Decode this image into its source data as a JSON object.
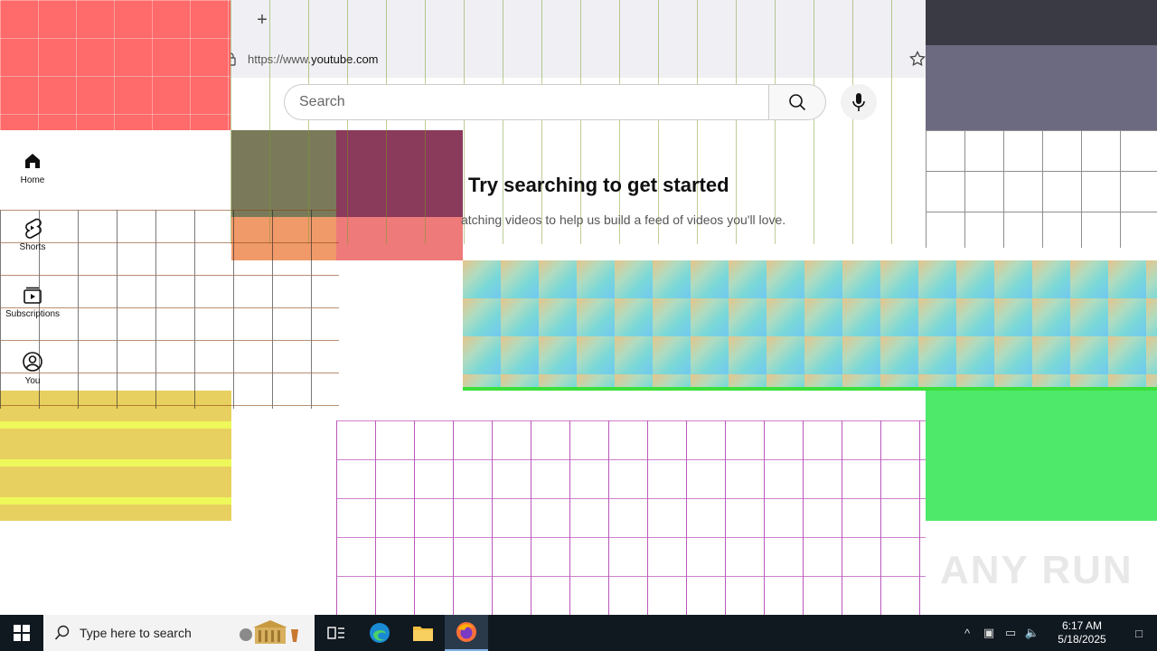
{
  "browser": {
    "url_prefix": "https://www.",
    "url_domain": "youtube.com",
    "newtab_symbol": "+"
  },
  "youtube": {
    "search_placeholder": "Search",
    "nav": [
      {
        "label": "Home",
        "icon": "home-icon"
      },
      {
        "label": "Shorts",
        "icon": "shorts-icon"
      },
      {
        "label": "Subscriptions",
        "icon": "subscriptions-icon"
      },
      {
        "label": "You",
        "icon": "account-icon"
      }
    ],
    "message": {
      "title": "Try searching to get started",
      "subtitle": "atching videos to help us build a feed of videos you'll love."
    }
  },
  "taskbar": {
    "search_placeholder": "Type here to search",
    "time": "6:17 AM",
    "date": "5/18/2025"
  },
  "watermark": "ANY RUN",
  "colors": {
    "pink_block": "#ff6a6a",
    "yellow_block": "#eef85a",
    "green_block": "#4ee86a",
    "gradient_block_start": "#e7c48a",
    "gradient_block_end": "#70c8f0",
    "taskbar_bg": "#101820"
  }
}
